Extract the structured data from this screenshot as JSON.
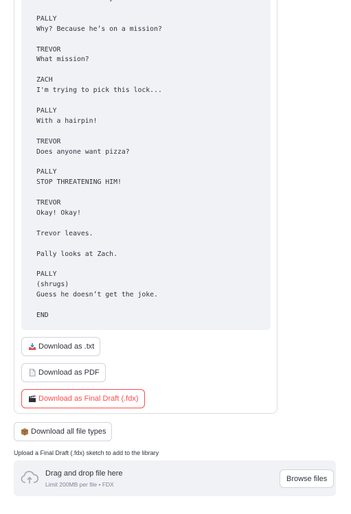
{
  "script": {
    "lines": [
      "Zach looks at Pally.",
      "",
      "PALLY",
      "Why? Because he’s on a mission?",
      "",
      "TREVOR",
      "What mission?",
      "",
      "ZACH",
      "I'm trying to pick this lock...",
      "",
      "PALLY",
      "With a hairpin!",
      "",
      "TREVOR",
      "Does anyone want pizza?",
      "",
      "PALLY",
      "STOP THREATENING HIM!",
      "",
      "TREVOR",
      "Okay! Okay!",
      "",
      "Trevor leaves.",
      "",
      "Pally looks at Zach.",
      "",
      "PALLY",
      "(shrugs)",
      "Guess he doesn’t get the joke.",
      "",
      "END"
    ]
  },
  "downloads": {
    "txt": {
      "icon": "inbox-tray-icon",
      "label": "Download as .txt"
    },
    "pdf": {
      "icon": "page-icon",
      "label": "Download as PDF"
    },
    "fdx": {
      "icon": "clapper-board-icon",
      "label": "Download as Final Draft (.fdx)"
    },
    "all": {
      "icon": "package-icon",
      "label": "Download all file types"
    }
  },
  "uploader": {
    "label": "Upload a Final Draft (.fdx) sketch to add to the library",
    "drop_title": "Drag and drop file here",
    "drop_sub": "Limit 200MB per file • FDX",
    "browse_label": "Browse files"
  },
  "colors": {
    "accent": "#ff4b4b",
    "code_bg": "#f0f2f6",
    "text": "#31333f",
    "muted": "#808495"
  }
}
